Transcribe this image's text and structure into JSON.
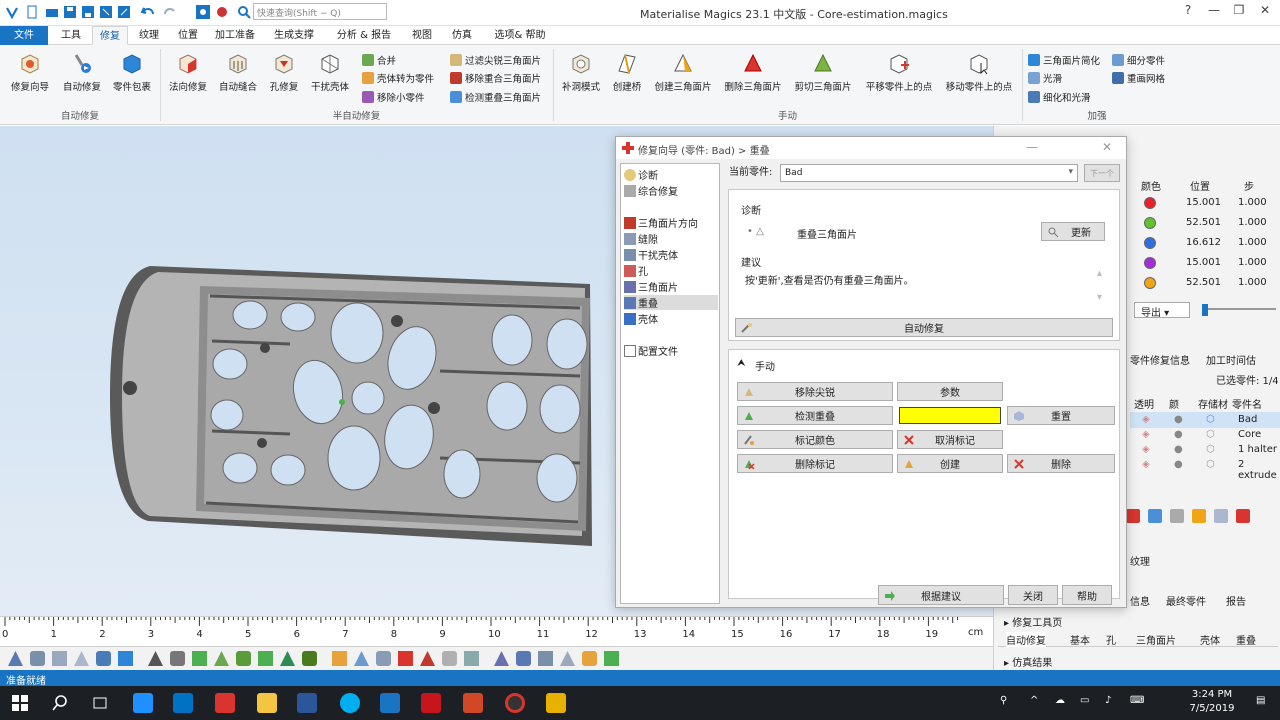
{
  "window": {
    "title": "Materialise Magics 23.1 中文版 - Core-estimation.magics",
    "search_placeholder": "快速查询(Shift − Q)"
  },
  "ribbon_tabs": [
    "文件",
    "工具",
    "修复",
    "纹理",
    "位置",
    "加工准备",
    "生成支撑",
    "分析 & 报告",
    "视图",
    "仿真",
    "选项& 帮助"
  ],
  "ribbon": {
    "auto_fix_buttons": [
      "修复向导",
      "自动修复",
      "零件包裹"
    ],
    "semi_auto_buttons": [
      "法向修复",
      "自动缝合",
      "孔修复",
      "干扰壳体"
    ],
    "semi_auto_small": [
      "合并",
      "壳体转为零件",
      "移除小零件"
    ],
    "semi_auto_small2": [
      "过滤尖锐三角面片",
      "移除重合三角面片",
      "检测重叠三角面片"
    ],
    "manual_buttons": [
      "补洞模式",
      "创建桥",
      "创建三角面片",
      "删除三角面片",
      "剪切三角面片",
      "平移零件上的点",
      "移动零件上的点"
    ],
    "enhance_small": [
      "三角面片简化",
      "光滑",
      "细化和光滑"
    ],
    "enhance_small2": [
      "细分零件",
      "重画网格"
    ],
    "group_labels": {
      "auto": "自动修复",
      "semi": "半自动修复",
      "manual": "手动",
      "enhance": "加强"
    }
  },
  "ruler": {
    "ticks": [
      "0",
      "1",
      "2",
      "3",
      "4",
      "5",
      "6",
      "7",
      "8",
      "9",
      "10",
      "11",
      "12",
      "13",
      "14",
      "15",
      "16",
      "17",
      "18",
      "19"
    ],
    "unit": "cm"
  },
  "status": {
    "text": "准备就绪"
  },
  "taskbar": {
    "time": "3:24 PM",
    "date": "7/5/2019"
  },
  "right_panel": {
    "headers": [
      "颜色",
      "位置",
      "步"
    ],
    "rows": [
      {
        "color": "#e8202a",
        "position": "15.001",
        "step": "1.000"
      },
      {
        "color": "#5dc52a",
        "position": "52.501",
        "step": "1.000"
      },
      {
        "color": "#2e6fe0",
        "position": "16.612",
        "step": "1.000"
      },
      {
        "color": "#a12ed8",
        "position": "15.001",
        "step": "1.000"
      },
      {
        "color": "#f0a418",
        "position": "52.501",
        "step": "1.000"
      }
    ],
    "export_label": "导出",
    "tabs_top": [
      "零件修复信息",
      "加工时间估"
    ],
    "selected": "已选零件: 1/4",
    "part_headers": [
      "透明",
      "颜",
      "存储材",
      "零件名"
    ],
    "parts": [
      "Bad",
      "Core",
      "1 halter",
      "2 extrude"
    ],
    "texture_label": "纹理",
    "tabs_bottom": [
      "信息",
      "最终零件",
      "报告"
    ],
    "fix_toolpage": "修复工具页",
    "fix_tabs": [
      "自动修复",
      "基本",
      "孔",
      "三角面片",
      "壳体",
      "重叠"
    ],
    "sim_results": "仿真结果"
  },
  "dialog": {
    "title": "修复向导 (零件: Bad) > 重叠",
    "nav": [
      "诊断",
      "综合修复",
      "三角面片方向",
      "缝隙",
      "干扰壳体",
      "孔",
      "三角面片",
      "重叠",
      "壳体",
      "配置文件"
    ],
    "current_part_label": "当前零件:",
    "current_part": "Bad",
    "next_label": "下一个",
    "diagnose_label": "诊断",
    "overlap_item": "重叠三角面片",
    "update_btn": "更新",
    "suggest_label": "建议",
    "suggest_text": "按'更新',查看是否仍有重叠三角面片。",
    "auto_fix_btn": "自动修复",
    "manual_label": "手动",
    "btn_remove_spikes": "移除尖锐",
    "btn_params": "参数",
    "btn_detect": "检测重叠",
    "btn_reset": "重置",
    "btn_mark_color": "标记颜色",
    "btn_unmark": "取消标记",
    "btn_delete_mark": "删除标记",
    "btn_create": "创建",
    "btn_delete": "删除",
    "btn_follow": "根据建议",
    "btn_close": "关闭",
    "btn_help": "帮助",
    "highlight_color": "#ffff00"
  }
}
